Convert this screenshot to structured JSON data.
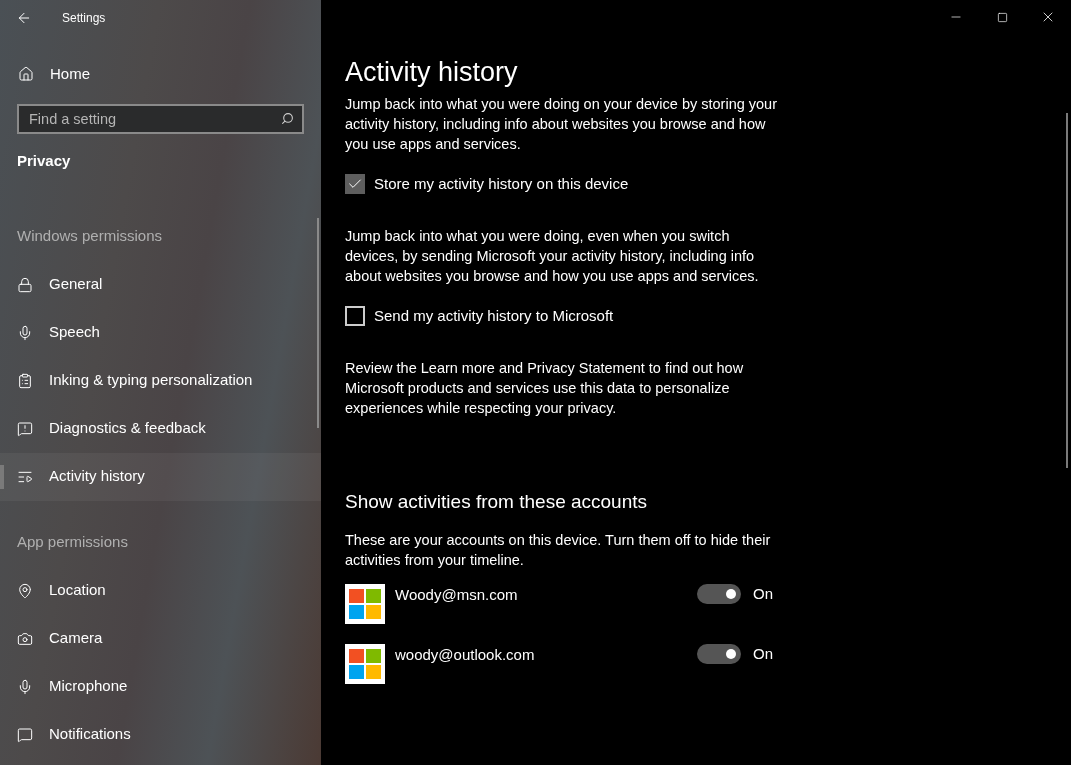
{
  "window": {
    "title": "Settings"
  },
  "sidebar": {
    "home": "Home",
    "search": {
      "placeholder": "Find a setting"
    },
    "category": "Privacy",
    "items": [
      {
        "kind": "section",
        "label": "Windows permissions"
      },
      {
        "kind": "item",
        "label": "General",
        "selected": false
      },
      {
        "kind": "item",
        "label": "Speech",
        "selected": false
      },
      {
        "kind": "item",
        "label": "Inking & typing personalization",
        "selected": false
      },
      {
        "kind": "item",
        "label": "Diagnostics & feedback",
        "selected": false
      },
      {
        "kind": "item",
        "label": "Activity history",
        "selected": true
      },
      {
        "kind": "section",
        "label": "App permissions"
      },
      {
        "kind": "item",
        "label": "Location",
        "selected": false
      },
      {
        "kind": "item",
        "label": "Camera",
        "selected": false
      },
      {
        "kind": "item",
        "label": "Microphone",
        "selected": false
      },
      {
        "kind": "item",
        "label": "Notifications",
        "selected": false
      }
    ]
  },
  "page": {
    "title": "Activity history",
    "blocks": [
      {
        "kind": "text",
        "text": "Jump back into what you were doing on your device by storing your activity history, including info about websites you browse and how you use apps and services."
      },
      {
        "kind": "checkbox",
        "label": "Store my activity history on this device",
        "checked": true
      },
      {
        "kind": "text",
        "text": "Jump back into what you were doing, even when you switch devices, by sending Microsoft your activity history, including info about websites you browse and how you use apps and services."
      },
      {
        "kind": "checkbox",
        "label": "Send my activity history to Microsoft",
        "checked": false
      },
      {
        "kind": "text",
        "text": "Review the Learn more and Privacy Statement to find out how Microsoft products and services use this data to personalize experiences while respecting your privacy."
      }
    ],
    "accounts_heading": "Show activities from these accounts",
    "accounts_text": "These are your accounts on this device. Turn them off to hide their activities from your timeline.",
    "accounts": [
      {
        "email": "Woody@msn.com",
        "on": true,
        "state": "On"
      },
      {
        "email": "woody@outlook.com",
        "on": true,
        "state": "On"
      }
    ]
  }
}
